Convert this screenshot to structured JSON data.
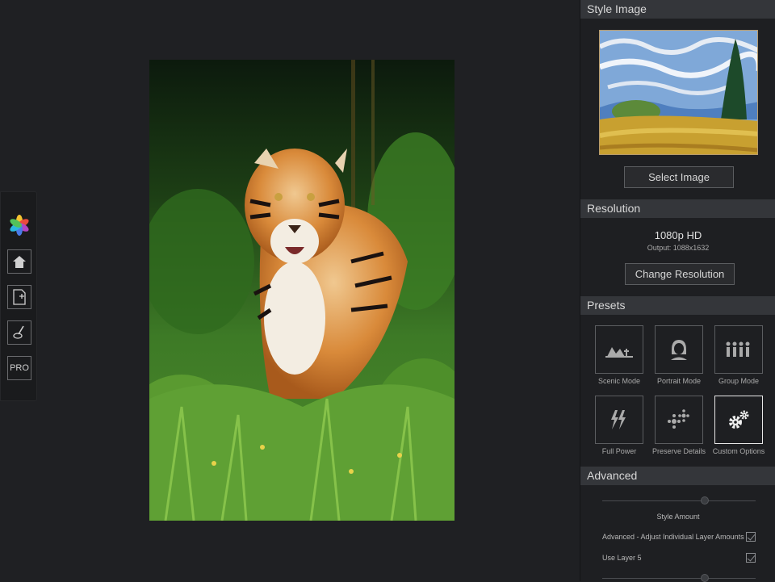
{
  "sidebar": {
    "tools": [
      {
        "name": "app-logo",
        "icon": "flower-logo-icon"
      },
      {
        "name": "home-button",
        "icon": "home-icon"
      },
      {
        "name": "new-file-button",
        "icon": "new-file-icon"
      },
      {
        "name": "brush-button",
        "icon": "brush-icon"
      },
      {
        "name": "pro-button",
        "label": "PRO"
      }
    ]
  },
  "panel": {
    "style_image": {
      "header": "Style Image",
      "select_button": "Select Image"
    },
    "resolution": {
      "header": "Resolution",
      "value": "1080p HD",
      "output": "Output: 1088x1632",
      "change_button": "Change Resolution"
    },
    "presets": {
      "header": "Presets",
      "items": [
        {
          "label": "Scenic Mode",
          "icon": "landscape-icon"
        },
        {
          "label": "Portrait Mode",
          "icon": "portrait-icon"
        },
        {
          "label": "Group Mode",
          "icon": "group-icon"
        },
        {
          "label": "Full Power",
          "icon": "lightning-icon"
        },
        {
          "label": "Preserve Details",
          "icon": "details-icon"
        },
        {
          "label": "Custom Options",
          "icon": "gears-icon",
          "active": true
        }
      ]
    },
    "advanced": {
      "header": "Advanced",
      "style_amount_label": "Style Amount",
      "adjust_layers_label": "Advanced - Adjust Individual Layer Amounts",
      "use_layer_label": "Use Layer 5",
      "adjust_layers_checked": true,
      "use_layer_checked": true
    }
  },
  "colors": {
    "background": "#1f2023",
    "panel": "#1e1f22",
    "header": "#34363a"
  }
}
